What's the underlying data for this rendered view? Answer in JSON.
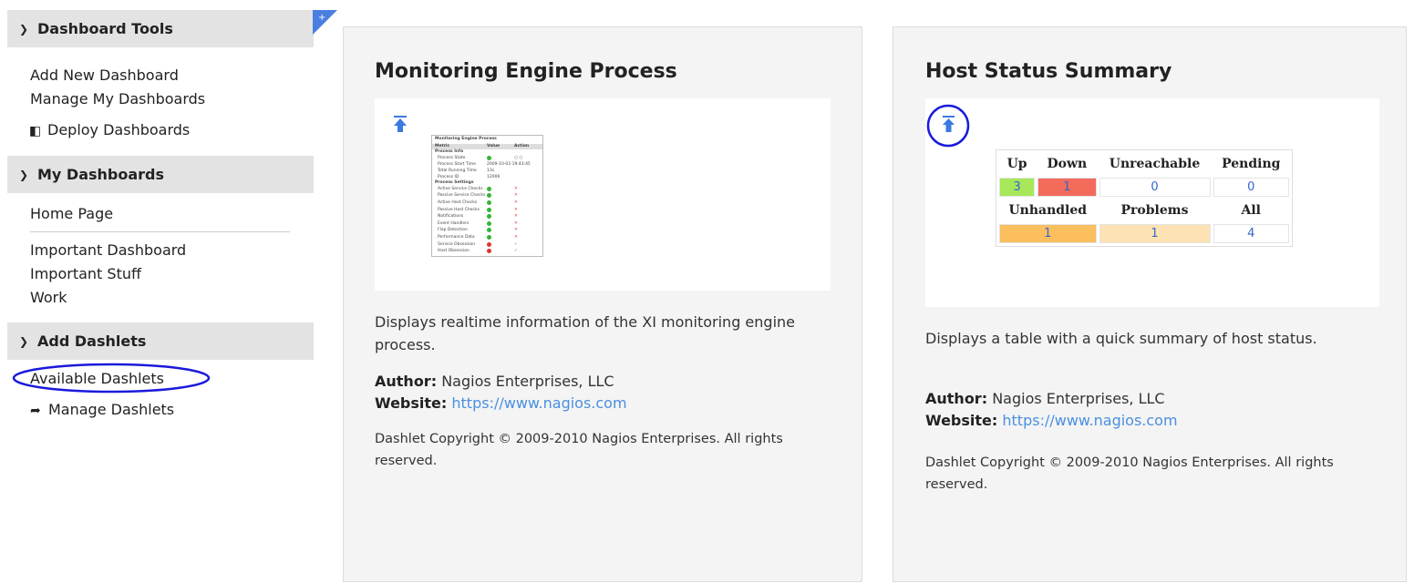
{
  "sidebar": {
    "sections": [
      {
        "title": "Dashboard Tools"
      },
      {
        "title": "My Dashboards"
      },
      {
        "title": "Add Dashlets"
      }
    ],
    "tools": {
      "add_new": "Add New Dashboard",
      "manage": "Manage My Dashboards",
      "deploy": "Deploy Dashboards"
    },
    "my_dashboards": {
      "home": "Home Page",
      "items": [
        "Important Dashboard",
        "Important Stuff",
        "Work"
      ]
    },
    "add_dashlets": {
      "available": "Available Dashlets",
      "manage": "Manage Dashlets"
    }
  },
  "panels": [
    {
      "title": "Monitoring Engine Process",
      "description": "Displays realtime information of the XI monitoring engine process.",
      "author_label": "Author:",
      "author": "Nagios Enterprises, LLC",
      "website_label": "Website:",
      "website": "https://www.nagios.com",
      "copyright": "Dashlet Copyright © 2009-2010 Nagios Enterprises. All rights reserved.",
      "mini_table": {
        "title": "Monitoring Engine Process",
        "headers": [
          "Metric",
          "Value",
          "Action"
        ],
        "group1": "Process Info",
        "rows1": [
          {
            "label": "Process State",
            "value": ""
          },
          {
            "label": "Process Start Time",
            "value": "2009-10-03 19:43:45"
          },
          {
            "label": "Total Running Time",
            "value": "13s"
          },
          {
            "label": "Process ID",
            "value": "12006"
          }
        ],
        "group2": "Process Settings",
        "rows2": [
          "Active Service Checks",
          "Passive Service Checks",
          "Active Host Checks",
          "Passive Host Checks",
          "Notifications",
          "Event Handlers",
          "Flap Detection",
          "Performance Data",
          "Service Obsession",
          "Host Obsession"
        ]
      }
    },
    {
      "title": "Host Status Summary",
      "description": "Displays a table with a quick summary of host status.",
      "author_label": "Author:",
      "author": "Nagios Enterprises, LLC",
      "website_label": "Website:",
      "website": "https://www.nagios.com",
      "copyright": "Dashlet Copyright © 2009-2010 Nagios Enterprises. All rights reserved.",
      "status_table": {
        "headers1": [
          "Up",
          "Down",
          "Unreachable",
          "Pending"
        ],
        "values1": [
          "3",
          "1",
          "0",
          "0"
        ],
        "headers2": [
          "Unhandled",
          "Problems",
          "All"
        ],
        "values2": [
          "1",
          "1",
          "4"
        ]
      }
    }
  ],
  "colors": {
    "up": "#a6e85a",
    "down": "#f26b5b",
    "unhandled": "#fbbf5e",
    "problems": "#fde3b3",
    "highlight_circle": "#1a1adb",
    "link": "#4a8fe0"
  }
}
